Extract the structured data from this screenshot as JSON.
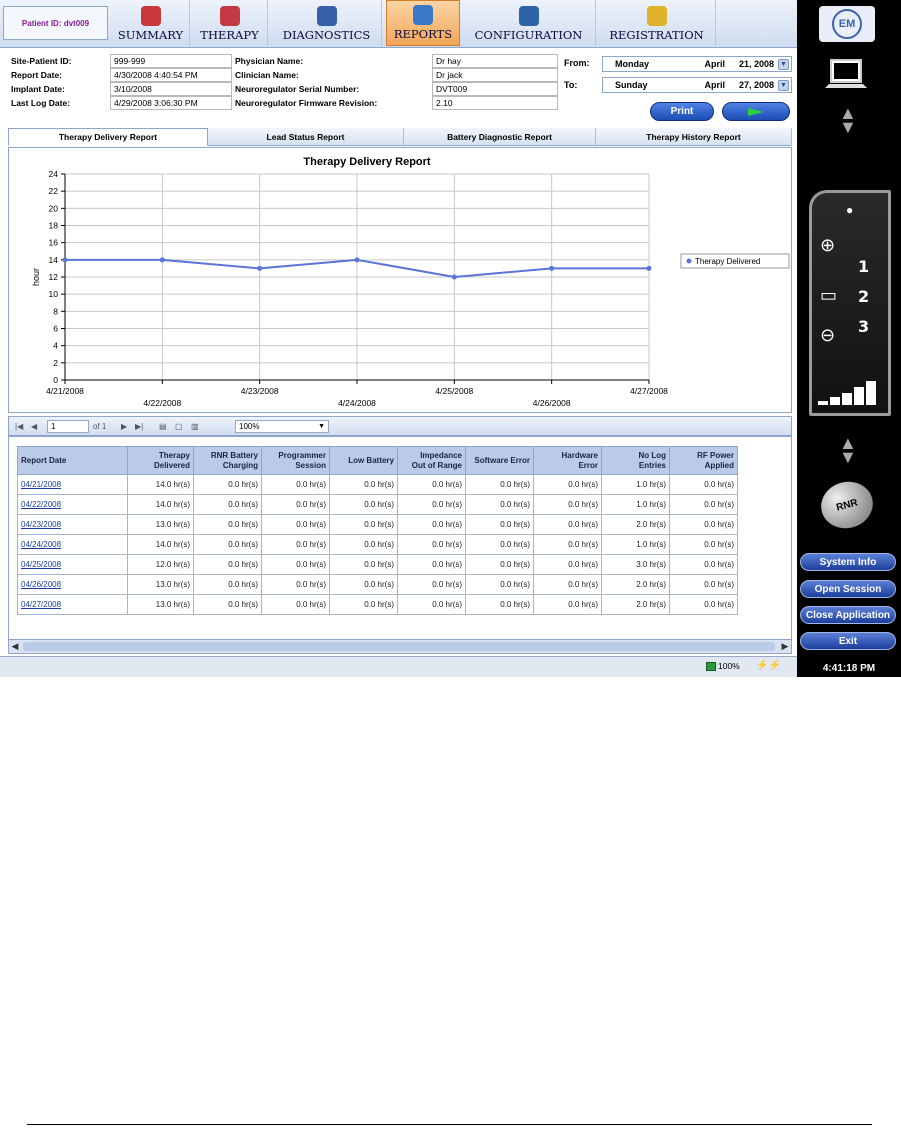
{
  "patient_id_label": "Patient ID: dvt009",
  "nav": {
    "tabs": [
      {
        "label": "SUMMARY",
        "color": "#c8373c"
      },
      {
        "label": "THERAPY",
        "color": "#c43a42"
      },
      {
        "label": "DIAGNOSTICS",
        "color": "#3660a8"
      },
      {
        "label": "REPORTS",
        "color": "#3a78c8"
      },
      {
        "label": "CONFIGURATION",
        "color": "#2d64a8"
      },
      {
        "label": "REGISTRATION",
        "color": "#e0b12b"
      }
    ],
    "active_index": 3
  },
  "info": {
    "site_patient_id_label": "Site-Patient ID:",
    "site_patient_id": "999-999",
    "report_date_label": "Report Date:",
    "report_date": "4/30/2008 4:40:54 PM",
    "implant_date_label": "Implant Date:",
    "implant_date": "3/10/2008",
    "last_log_date_label": "Last Log Date:",
    "last_log_date": "4/29/2008 3:06:30 PM",
    "physician_label": "Physician Name:",
    "physician": "Dr hay",
    "clinician_label": "Clinician Name:",
    "clinician": "Dr jack",
    "serial_label": "Neuroregulator Serial Number:",
    "serial": "DVT009",
    "firmware_label": "Neuroregulator Firmware Revision:",
    "firmware": "2.10"
  },
  "daterange": {
    "from_label": "From:",
    "from_day": "Monday",
    "from_month": "April",
    "from_date": "21, 2008",
    "to_label": "To:",
    "to_day": "Sunday",
    "to_month": "April",
    "to_date": "27, 2008",
    "print_label": "Print",
    "go_icon": "play-arrow-icon"
  },
  "report_tabs": [
    "Therapy Delivery Report",
    "Lead Status Report",
    "Battery Diagnostic Report",
    "Therapy History Report"
  ],
  "chart_data": {
    "type": "line",
    "title": "Therapy Delivery Report",
    "ylabel": "hour",
    "xlabel": "",
    "categories": [
      "4/21/2008",
      "4/22/2008",
      "4/23/2008",
      "4/24/2008",
      "4/25/2008",
      "4/26/2008",
      "4/27/2008"
    ],
    "series": [
      {
        "name": "Therapy Delivered",
        "values": [
          14,
          14,
          13,
          14,
          12,
          13,
          13
        ],
        "color": "#5b74d6"
      }
    ],
    "ylim": [
      0,
      24
    ],
    "yticks": [
      0,
      2,
      4,
      6,
      8,
      10,
      12,
      14,
      16,
      18,
      20,
      22,
      24
    ],
    "grid": true,
    "legend": "right"
  },
  "toolbar": {
    "page": "1",
    "of_label": "of 1",
    "zoom": "100%"
  },
  "table": {
    "headers": [
      "Report Date",
      "Therapy\nDelivered",
      "RNR Battery\nCharging",
      "Programmer\nSession",
      "Low Battery",
      "Impedance\nOut of Range",
      "Software Error",
      "Hardware\nError",
      "No Log\nEntries",
      "RF Power\nApplied"
    ],
    "rows": [
      [
        "04/21/2008",
        "14.0 hr(s)",
        "0.0 hr(s)",
        "0.0 hr(s)",
        "0.0 hr(s)",
        "0.0 hr(s)",
        "0.0 hr(s)",
        "0.0 hr(s)",
        "1.0 hr(s)",
        "0.0 hr(s)"
      ],
      [
        "04/22/2008",
        "14.0 hr(s)",
        "0.0 hr(s)",
        "0.0 hr(s)",
        "0.0 hr(s)",
        "0.0 hr(s)",
        "0.0 hr(s)",
        "0.0 hr(s)",
        "1.0 hr(s)",
        "0.0 hr(s)"
      ],
      [
        "04/23/2008",
        "13.0 hr(s)",
        "0.0 hr(s)",
        "0.0 hr(s)",
        "0.0 hr(s)",
        "0.0 hr(s)",
        "0.0 hr(s)",
        "0.0 hr(s)",
        "2.0 hr(s)",
        "0.0 hr(s)"
      ],
      [
        "04/24/2008",
        "14.0 hr(s)",
        "0.0 hr(s)",
        "0.0 hr(s)",
        "0.0 hr(s)",
        "0.0 hr(s)",
        "0.0 hr(s)",
        "0.0 hr(s)",
        "1.0 hr(s)",
        "0.0 hr(s)"
      ],
      [
        "04/25/2008",
        "12.0 hr(s)",
        "0.0 hr(s)",
        "0.0 hr(s)",
        "0.0 hr(s)",
        "0.0 hr(s)",
        "0.0 hr(s)",
        "0.0 hr(s)",
        "3.0 hr(s)",
        "0.0 hr(s)"
      ],
      [
        "04/26/2008",
        "13.0 hr(s)",
        "0.0 hr(s)",
        "0.0 hr(s)",
        "0.0 hr(s)",
        "0.0 hr(s)",
        "0.0 hr(s)",
        "0.0 hr(s)",
        "2.0 hr(s)",
        "0.0 hr(s)"
      ],
      [
        "04/27/2008",
        "13.0 hr(s)",
        "0.0 hr(s)",
        "0.0 hr(s)",
        "0.0 hr(s)",
        "0.0 hr(s)",
        "0.0 hr(s)",
        "0.0 hr(s)",
        "2.0 hr(s)",
        "0.0 hr(s)"
      ]
    ]
  },
  "right_panel": {
    "logo_text": "EM",
    "device_numbers": [
      "1",
      "2",
      "3"
    ],
    "rnr_label": "RNR",
    "buttons": [
      "System Info",
      "Open Session",
      "Close Application",
      "Exit"
    ],
    "clock": "4:41:18 PM"
  },
  "status": {
    "zoom": "100%"
  }
}
